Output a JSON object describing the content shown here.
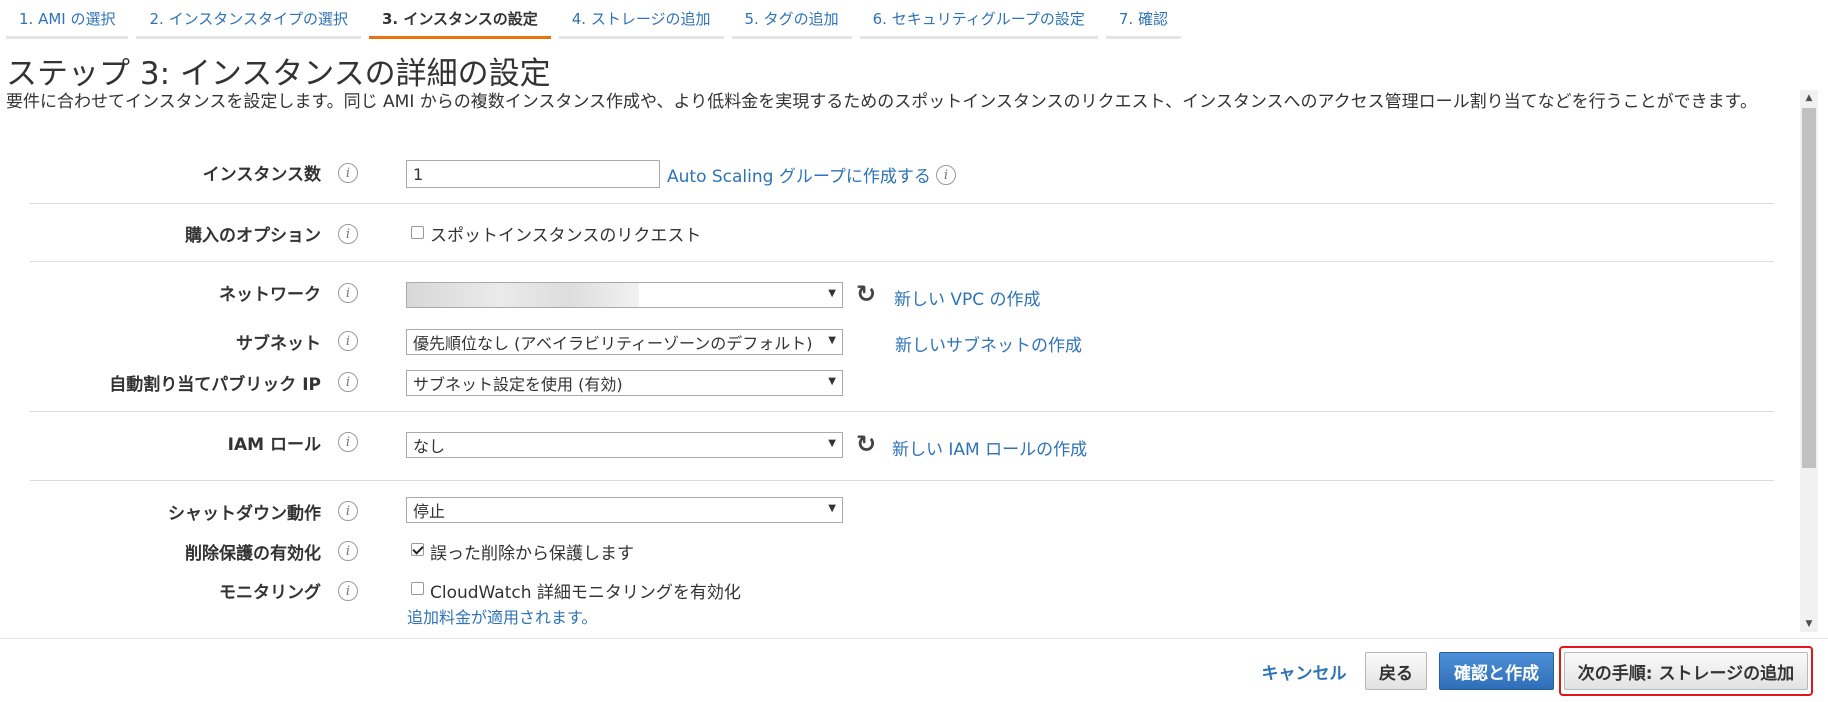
{
  "tabs": [
    {
      "label": "1. AMI の選択"
    },
    {
      "label": "2. インスタンスタイプの選択"
    },
    {
      "label": "3. インスタンスの設定"
    },
    {
      "label": "4. ストレージの追加"
    },
    {
      "label": "5. タグの追加"
    },
    {
      "label": "6. セキュリティグループの設定"
    },
    {
      "label": "7. 確認"
    }
  ],
  "heading": {
    "title": "ステップ 3: インスタンスの詳細の設定",
    "description": "要件に合わせてインスタンスを設定します。同じ AMI からの複数インスタンス作成や、より低料金を実現するためのスポットインスタンスのリクエスト、インスタンスへのアクセス管理ロール割り当てなどを行うことができます。"
  },
  "form": {
    "instance_count": {
      "label": "インスタンス数",
      "value": "1",
      "link": "Auto Scaling グループに作成する"
    },
    "purchase_option": {
      "label": "購入のオプション",
      "checkbox_label": "スポットインスタンスのリクエスト",
      "checked": false
    },
    "network": {
      "label": "ネットワーク",
      "value": "",
      "link": "新しい VPC の作成"
    },
    "subnet": {
      "label": "サブネット",
      "value": "優先順位なし (アベイラビリティーゾーンのデフォルト)",
      "link": "新しいサブネットの作成"
    },
    "public_ip": {
      "label": "自動割り当てパブリック IP",
      "value": "サブネット設定を使用 (有効)"
    },
    "iam_role": {
      "label": "IAM ロール",
      "value": "なし",
      "link": "新しい IAM ロールの作成"
    },
    "shutdown": {
      "label": "シャットダウン動作",
      "value": "停止"
    },
    "termination_protection": {
      "label": "削除保護の有効化",
      "checkbox_label": "誤った削除から保護します",
      "checked": true
    },
    "monitoring": {
      "label": "モニタリング",
      "checkbox_label": "CloudWatch 詳細モニタリングを有効化",
      "checked": false,
      "note": "追加料金が適用されます。"
    }
  },
  "footer": {
    "cancel_label": "キャンセル",
    "back_label": "戻る",
    "review_label": "確認と作成",
    "next_label": "次の手順: ストレージの追加"
  },
  "icons": {
    "info": "info-icon",
    "refresh": "refresh-icon",
    "caret": "chevron-down-icon"
  },
  "colors": {
    "link": "#2e73b8",
    "active_tab": "#ec7211",
    "primary_button": "#2f6fb8",
    "highlight": "#e01818"
  }
}
